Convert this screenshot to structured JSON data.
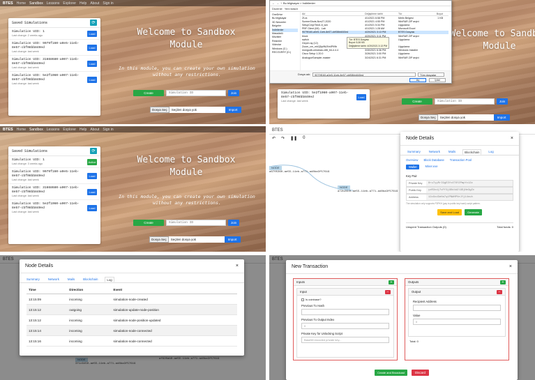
{
  "nav": {
    "brand": "BTES",
    "links": [
      "Home",
      "Sandbox",
      "Lessons",
      "Explorer",
      "Help",
      "About",
      "Sign in"
    ]
  },
  "sandbox": {
    "card_title": "Saved Simulations",
    "hero_title_1": "Welcome to Sandbox",
    "hero_title_2": "Module",
    "hero_sub_1": "In this module, you can create your own simulation",
    "hero_sub_2": "without any restrictions.",
    "create_label": "Create",
    "sim_id_placeholder": "Simulation ID",
    "join_label": "Join",
    "file_choose": "Dosya Seç",
    "file_none": "Seçilen dosya yok",
    "import_label": "Import",
    "load_label": "Load",
    "active_label": "Active",
    "sims": [
      {
        "title": "Simulation UID: 1",
        "sub": "Last change: 2 weeks ago"
      },
      {
        "title": "Simulation UID: 9079f160-a0e5-11eb-8e57-cbf08bb840ed",
        "sub": "Last change: last week"
      },
      {
        "title": "Simulation UID: 31668680-a907-11eb-8e57-cbf08bb840ed",
        "sub": "Last change: last week"
      },
      {
        "title": "Simulation UID: 5e2f1060-a907-11eb-8e57-cbf08bb840ed",
        "sub": "Last change: last week"
      }
    ],
    "sims_p3": [
      {
        "title": "Simulation UID: 1",
        "sub": "Last change: 3 weeks ago"
      },
      {
        "title": "Simulation UID: 9079f160-a0e5-11eb-8e57-cbf08bb840ed",
        "sub": "Last change: last week"
      },
      {
        "title": "Simulation UID: 31668680-a907-11eb-8e57-cbf08bb840ed",
        "sub": "Last change: last week"
      },
      {
        "title": "Simulation UID: 5e2f1060-a907-11eb-8e57-cbf08bb840ed",
        "sub": "Last change: last week"
      }
    ],
    "p2_sim": {
      "title": "Simulation UID: 5e2f1060-a907-11eb-8e57-cbf08bb840ed",
      "sub": "Last change: last week"
    }
  },
  "dialog": {
    "path": "Bu bilgisayar > İndirilenler",
    "organize": "Düzenle",
    "new_folder": "Yeni klasör",
    "tree": [
      "OneDrive",
      "Bu bilgisayar",
      "3D Nesneler",
      "Belgeler",
      "İndirilenler",
      "Masaüstü",
      "Müzikler",
      "Resimler",
      "Videolar",
      "Windows (C:)",
      "RECOVERY (D:)"
    ],
    "cols": [
      "Ad",
      "Değiştirme tarihi",
      "Tür",
      "Boyut"
    ],
    "files": [
      {
        "name": "2f-ra",
        "date": "4/1/2021 6:58 PM",
        "type": "Metin Belgesi",
        "size": "1 KB"
      },
      {
        "name": "ScreenShots-Nov27-2020",
        "date": "4/1/2021 4:55 PM",
        "type": "WinRAR ZIP arşivi",
        "size": ""
      },
      {
        "name": "SetupCmp/Test1.8_win",
        "date": "4/1/2021 5:34 PM",
        "type": "Uygulama",
        "size": ""
      },
      {
        "name": "PBF Client (IM) - Lab",
        "date": "4/1/2021 1:28 AM",
        "type": "Microsoft Excel",
        "size": ""
      },
      {
        "name": "9079f160-a0e5-11eb-8e57-cbf08bb840ed",
        "date": "4/20/2021 3:13 PM",
        "type": "BTES Dosyası",
        "size": ""
      },
      {
        "name": "block",
        "date": "4/20/2021 3:11 PM",
        "type": "WinRAR ZIP arşivi",
        "size": ""
      },
      {
        "name": "switch",
        "date": "4/18/2021 9:10 PM",
        "type": "Uygulama",
        "size": ""
      },
      {
        "name": "Geçen ay (12)",
        "date": "",
        "type": "",
        "size": ""
      },
      {
        "name": "Zoom_cm_mh2j5p9NJNr4PiI9b",
        "date": "3/30/2021 6:09 PM",
        "type": "Uygulama",
        "size": ""
      },
      {
        "name": "mongodb-windows-x86_64-4.4.4",
        "date": "3/30/2021 6:36 PM",
        "type": "Windows Installer",
        "size": ""
      },
      {
        "name": "Cisco Setup 1.20.0",
        "date": "3/26/2021 3:00 PM",
        "type": "Uygulama",
        "size": ""
      },
      {
        "name": "AnalogueSampler-master",
        "date": "3/24/2021 6:31 PM",
        "type": "WinRAR ZIP arşivi",
        "size": ""
      }
    ],
    "tooltip_1": "Tür: BTES Dosyası",
    "tooltip_2": "Boyut: 5,06 KB",
    "tooltip_3": "Değiştirme tarihi: 4/20/2021 3:13 PM",
    "filename_label": "Dosya adı:",
    "filename_value": "9079f160-a0e5-11eb-8e57-cbf08bb840ed",
    "filter": "Tüm dosyalar",
    "open": "Aç",
    "cancel": "İptal"
  },
  "graph": {
    "node1_label": "NODE",
    "node1_uid": "a6705360-ae55-11eb-a771-ad8ba3f57619",
    "node2_label": "NODE",
    "node2_uid": "a72b24c0-ae55-11eb-a771-ad8ba3f57619",
    "zoom": "0",
    "p5_node_uid": "3f1d3450-ae55-11eb-a771-ad8ba3f57619",
    "p5_node2_uid": "af920ab0-ae55-11eb-a771-ad8ba3f57619"
  },
  "node_details": {
    "title": "Node Details",
    "tabs": [
      "Summary",
      "Network",
      "Mails",
      "Blockchain",
      "Log"
    ],
    "subtabs": [
      "Overview",
      "Block Database",
      "Transaction Pool"
    ],
    "wallet_tabs": [
      "Wallet",
      "Miner.exe"
    ],
    "key_pair": "Key Pair",
    "private_key_label": "Private Key",
    "private_key": "8ru7yyRrI9gE3Yc4T6Y2PmpYc12z",
    "public_key_label": "Public Key",
    "public_key": "yzR3xdj7vFf3j9Dd4d2l9DjNe3gZc",
    "address_label": "Address",
    "address": "12z9xd3eHa7q1PNWHPVeJYj14nuh",
    "note": "The simulation only supports P2PKH (pay to public key hash) script pattern.",
    "save_load": "Save and Load",
    "generate": "Generate",
    "unspent": "Unspent Transaction Outputs (0)",
    "total": "Total funds: 0",
    "log_cols": [
      "Time",
      "Direction",
      "Event"
    ],
    "log_rows": [
      [
        "13:15:09",
        "incoming",
        "simulation-node-created"
      ],
      [
        "13:15:12",
        "outgoing",
        "simulation-update-node-position"
      ],
      [
        "13:15:12",
        "incoming",
        "simulation-node-position-updated"
      ],
      [
        "13:15:14",
        "incoming",
        "simulation-node-connected"
      ],
      [
        "13:15:16",
        "incoming",
        "simulation-node-connected"
      ]
    ]
  },
  "new_tx": {
    "title": "New Transaction",
    "inputs": "Inputs",
    "outputs": "Outputs",
    "input": "Input",
    "output": "Output",
    "is_coinbase": "Is coinbase?",
    "prev_hash": "Previous Tx Hash",
    "prev_index": "Previous Tx Output Index",
    "prev_index_val": "0",
    "priv_key_label": "Private Key for Unlocking Script",
    "priv_key_ph": "Base58 encoded private key...",
    "recipient": "Recipient Address",
    "value": "Value",
    "value_val": "0",
    "total": "Total: 0",
    "create_broadcast": "Create and Broadcast",
    "discard": "Discard"
  }
}
